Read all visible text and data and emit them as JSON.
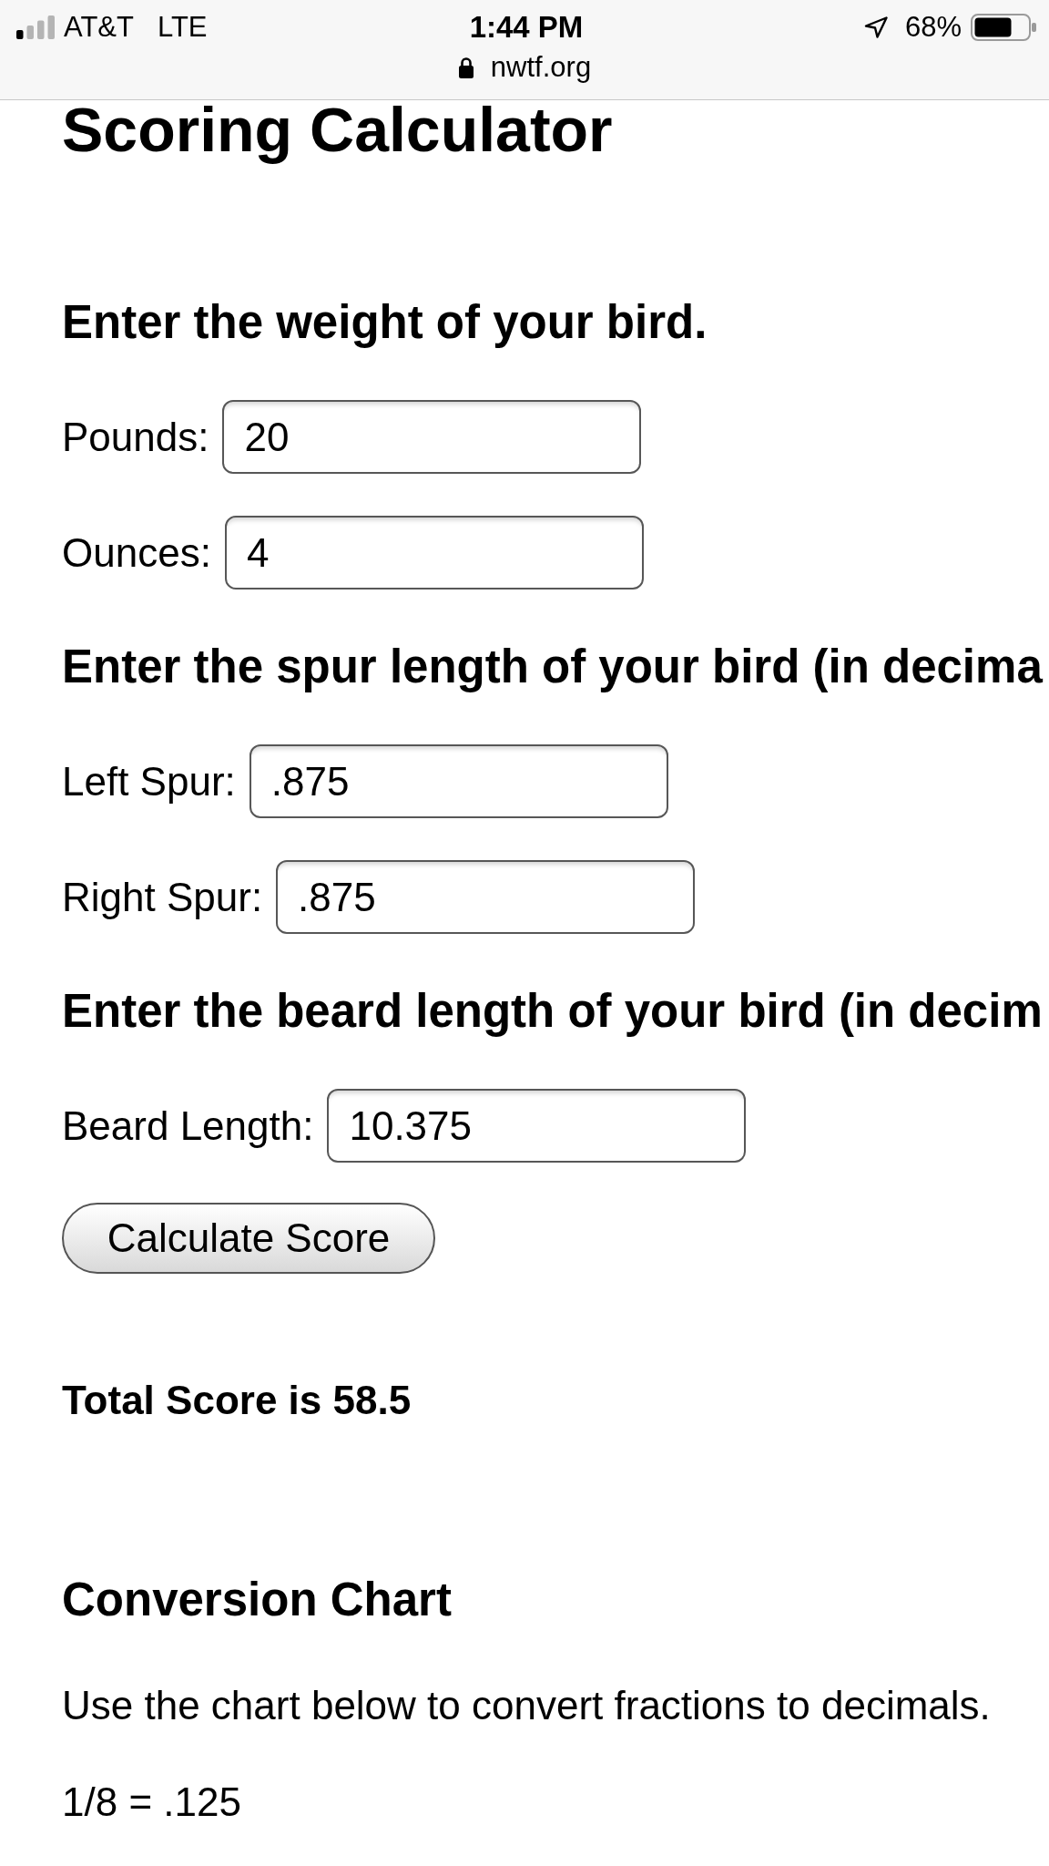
{
  "status_bar": {
    "carrier": "AT&T",
    "network": "LTE",
    "time": "1:44 PM",
    "battery_percent": "68%",
    "url": "nwtf.org"
  },
  "title": "Scoring Calculator",
  "sections": [
    {
      "heading": "Enter the weight of your bird.",
      "fields": [
        {
          "label": "Pounds:",
          "value": "20"
        },
        {
          "label": "Ounces:",
          "value": "4"
        }
      ]
    },
    {
      "heading": "Enter the spur length of your bird (in decima",
      "fields": [
        {
          "label": "Left Spur:",
          "value": ".875"
        },
        {
          "label": "Right Spur:",
          "value": ".875"
        }
      ]
    },
    {
      "heading": "Enter the beard length of your bird (in decim",
      "fields": [
        {
          "label": "Beard Length:",
          "value": "10.375"
        }
      ]
    }
  ],
  "button": "Calculate Score",
  "result": "Total Score is 58.5",
  "conversion": {
    "heading": "Conversion Chart",
    "intro": "Use the chart below to convert fractions to decimals.",
    "rows": [
      "1/8 = .125"
    ]
  }
}
